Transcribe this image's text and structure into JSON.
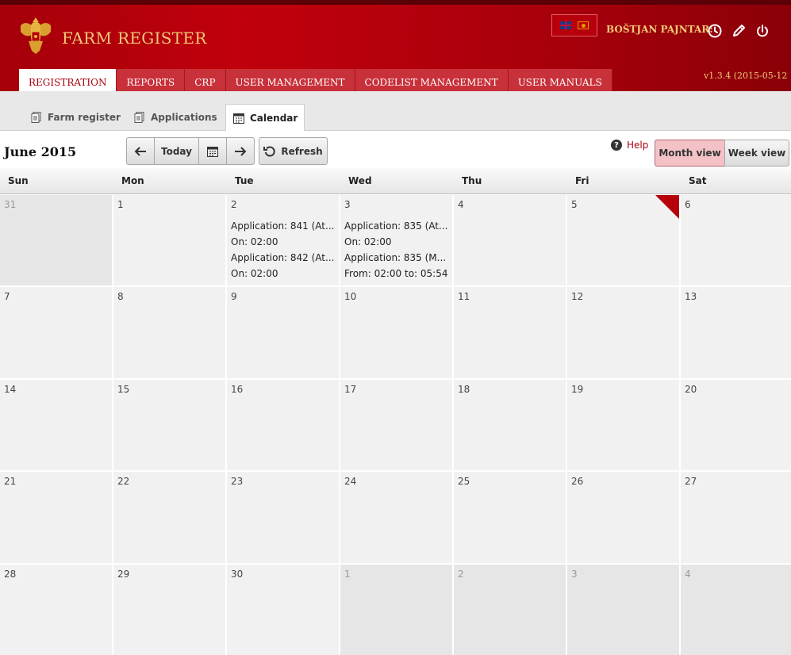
{
  "header": {
    "app_title": "FARM REGISTER",
    "username": "BOŠTJAN PAJNTAR:",
    "version": "v1.3.4 (2015-05-12",
    "icons": [
      "coat-of-arms-icon",
      "uk-flag-icon",
      "montenegro-flag-icon",
      "clock-icon",
      "pencil-icon",
      "power-icon"
    ]
  },
  "nav": {
    "items": [
      {
        "label": "REGISTRATION",
        "active": true
      },
      {
        "label": "REPORTS"
      },
      {
        "label": "CRP"
      },
      {
        "label": "USER MANAGEMENT"
      },
      {
        "label": "CODELIST MANAGEMENT"
      },
      {
        "label": "USER MANUALS"
      }
    ]
  },
  "subtabs": [
    {
      "label": "Farm register",
      "icon": "document-icon"
    },
    {
      "label": "Applications",
      "icon": "document-icon"
    },
    {
      "label": "Calendar",
      "icon": "calendar-icon",
      "active": true
    }
  ],
  "toolbar": {
    "month_title": "June 2015",
    "today_label": "Today",
    "refresh_label": "Refresh",
    "help_label": "Help",
    "month_view_label": "Month view",
    "week_view_label": "Week view"
  },
  "calendar": {
    "weekdays": [
      "Sun",
      "Mon",
      "Tue",
      "Wed",
      "Thu",
      "Fri",
      "Sat"
    ],
    "weeks": [
      [
        {
          "day": "31",
          "other": true
        },
        {
          "day": "1"
        },
        {
          "day": "2",
          "events": [
            "Application: 841 (At...",
            "On: 02:00",
            "Application: 842 (At...",
            "On: 02:00"
          ]
        },
        {
          "day": "3",
          "events": [
            "Application: 835 (At...",
            "On: 02:00",
            "Application: 835 (M...",
            "From: 02:00 to: 05:54"
          ]
        },
        {
          "day": "4"
        },
        {
          "day": "5",
          "today": true
        },
        {
          "day": "6"
        }
      ],
      [
        {
          "day": "7"
        },
        {
          "day": "8"
        },
        {
          "day": "9"
        },
        {
          "day": "10"
        },
        {
          "day": "11"
        },
        {
          "day": "12"
        },
        {
          "day": "13"
        }
      ],
      [
        {
          "day": "14"
        },
        {
          "day": "15"
        },
        {
          "day": "16"
        },
        {
          "day": "17"
        },
        {
          "day": "18"
        },
        {
          "day": "19"
        },
        {
          "day": "20"
        }
      ],
      [
        {
          "day": "21"
        },
        {
          "day": "22"
        },
        {
          "day": "23"
        },
        {
          "day": "24"
        },
        {
          "day": "25"
        },
        {
          "day": "26"
        },
        {
          "day": "27"
        }
      ],
      [
        {
          "day": "28"
        },
        {
          "day": "29"
        },
        {
          "day": "30"
        },
        {
          "day": "1",
          "other": true
        },
        {
          "day": "2",
          "other": true
        },
        {
          "day": "3",
          "other": true
        },
        {
          "day": "4",
          "other": true
        }
      ]
    ]
  },
  "colors": {
    "brand_red": "#b5000c",
    "gold": "#f3c87a",
    "active_view": "#f4c2c6"
  }
}
